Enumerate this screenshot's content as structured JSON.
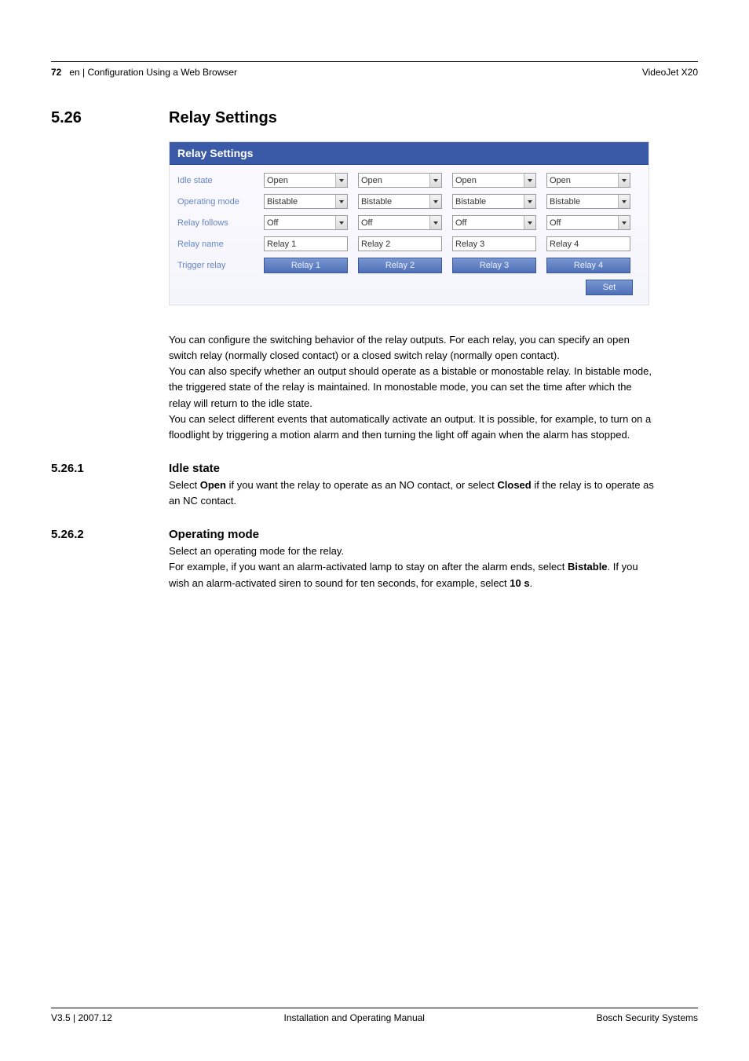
{
  "header": {
    "page_number": "72",
    "header_left": "en | Configuration Using a Web Browser",
    "header_right": "VideoJet X20"
  },
  "section": {
    "number": "5.26",
    "title": "Relay Settings"
  },
  "panel": {
    "title": "Relay Settings",
    "rows": {
      "idle_state": {
        "label": "Idle state",
        "values": [
          "Open",
          "Open",
          "Open",
          "Open"
        ]
      },
      "operating_mode": {
        "label": "Operating mode",
        "values": [
          "Bistable",
          "Bistable",
          "Bistable",
          "Bistable"
        ]
      },
      "relay_follows": {
        "label": "Relay follows",
        "values": [
          "Off",
          "Off",
          "Off",
          "Off"
        ]
      },
      "relay_name": {
        "label": "Relay name",
        "values": [
          "Relay 1",
          "Relay 2",
          "Relay 3",
          "Relay 4"
        ]
      },
      "trigger_relay": {
        "label": "Trigger relay",
        "values": [
          "Relay 1",
          "Relay 2",
          "Relay 3",
          "Relay 4"
        ]
      }
    },
    "set_button": "Set"
  },
  "paragraphs": {
    "p1": "You can configure the switching behavior of the relay outputs. For each relay, you can specify an open switch relay (normally closed contact) or a closed switch relay (normally open contact).",
    "p2": "You can also specify whether an output should operate as a bistable or monostable relay. In bistable mode, the triggered state of the relay is maintained. In monostable mode, you can set the time after which the relay will return to the idle state.",
    "p3": "You can select different events that automatically activate an output. It is possible, for example, to turn on a floodlight by triggering a motion alarm and then turning the light off again when the alarm has stopped."
  },
  "sub1": {
    "number": "5.26.1",
    "title": "Idle state",
    "pre": "Select ",
    "bold1": "Open",
    "mid": " if you want the relay to operate as an NO contact, or select ",
    "bold2": "Closed",
    "post": " if the relay is to operate as an NC contact."
  },
  "sub2": {
    "number": "5.26.2",
    "title": "Operating mode",
    "line1": "Select an operating mode for the relay.",
    "line2_pre": "For example, if you want an alarm-activated lamp to stay on after the alarm ends, select ",
    "line2_b1": "Bistable",
    "line2_mid": ". If you wish an alarm-activated siren to sound for ten seconds, for example, select ",
    "line2_b2": "10 s",
    "line2_post": "."
  },
  "footer": {
    "left": "V3.5 | 2007.12",
    "center": "Installation and Operating Manual",
    "right": "Bosch Security Systems"
  }
}
